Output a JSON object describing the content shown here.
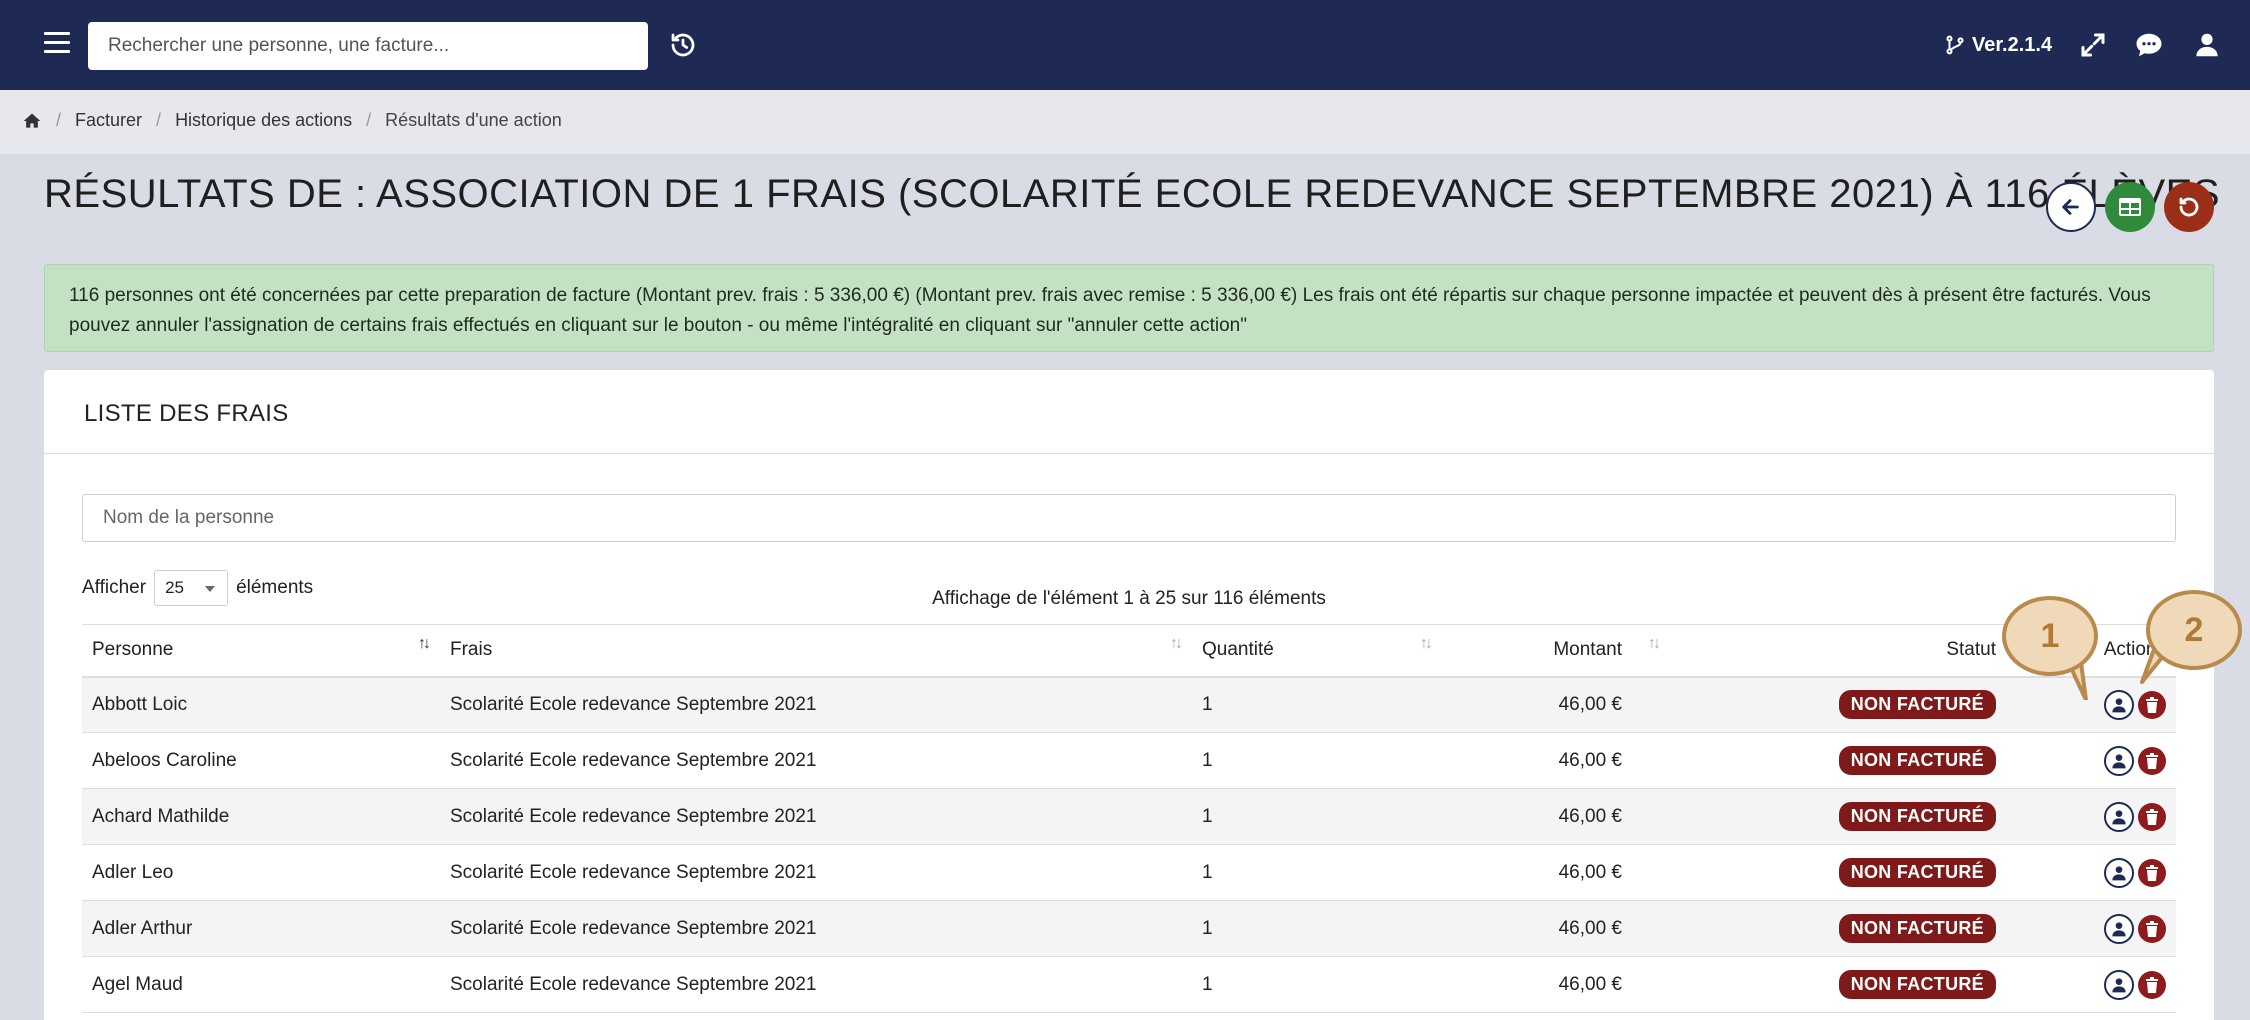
{
  "topbar": {
    "search_placeholder": "Rechercher une personne, une facture...",
    "version": "Ver.2.1.4"
  },
  "breadcrumb": [
    "Facturer",
    "Historique des actions",
    "Résultats d'une action"
  ],
  "title": "RÉSULTATS DE : ASSOCIATION DE 1 FRAIS (SCOLARITÉ ECOLE REDEVANCE SEPTEMBRE 2021) À 116 ÉLÈVES",
  "alert": "116 personnes ont été concernées par cette preparation de facture (Montant prev. frais : 5 336,00 €) (Montant prev. frais avec remise : 5 336,00 €) Les frais ont été répartis sur chaque personne impactée et peuvent dès à présent être facturés. Vous pouvez annuler l'assignation de certains frais effectués en cliquant sur le bouton - ou même l'intégralité en cliquant sur \"annuler cette action\"",
  "card": {
    "title": "LISTE DES FRAIS",
    "filter_placeholder": "Nom de la personne",
    "show_label": "Afficher",
    "page_size": "25",
    "elements_label": "éléments",
    "info": "Affichage de l'élément 1 à 25 sur 116 éléments"
  },
  "table": {
    "headers": {
      "person": "Personne",
      "fee": "Frais",
      "qty": "Quantité",
      "amount": "Montant",
      "status": "Statut",
      "actions": "Actions"
    },
    "rows": [
      {
        "person": "Abbott Loic",
        "fee": "Scolarité Ecole redevance Septembre 2021",
        "qty": "1",
        "amount": "46,00 €",
        "status": "NON FACTURÉ"
      },
      {
        "person": "Abeloos Caroline",
        "fee": "Scolarité Ecole redevance Septembre 2021",
        "qty": "1",
        "amount": "46,00 €",
        "status": "NON FACTURÉ"
      },
      {
        "person": "Achard Mathilde",
        "fee": "Scolarité Ecole redevance Septembre 2021",
        "qty": "1",
        "amount": "46,00 €",
        "status": "NON FACTURÉ"
      },
      {
        "person": "Adler Leo",
        "fee": "Scolarité Ecole redevance Septembre 2021",
        "qty": "1",
        "amount": "46,00 €",
        "status": "NON FACTURÉ"
      },
      {
        "person": "Adler Arthur",
        "fee": "Scolarité Ecole redevance Septembre 2021",
        "qty": "1",
        "amount": "46,00 €",
        "status": "NON FACTURÉ"
      },
      {
        "person": "Agel Maud",
        "fee": "Scolarité Ecole redevance Septembre 2021",
        "qty": "1",
        "amount": "46,00 €",
        "status": "NON FACTURÉ"
      }
    ]
  },
  "callouts": [
    "1",
    "2"
  ]
}
